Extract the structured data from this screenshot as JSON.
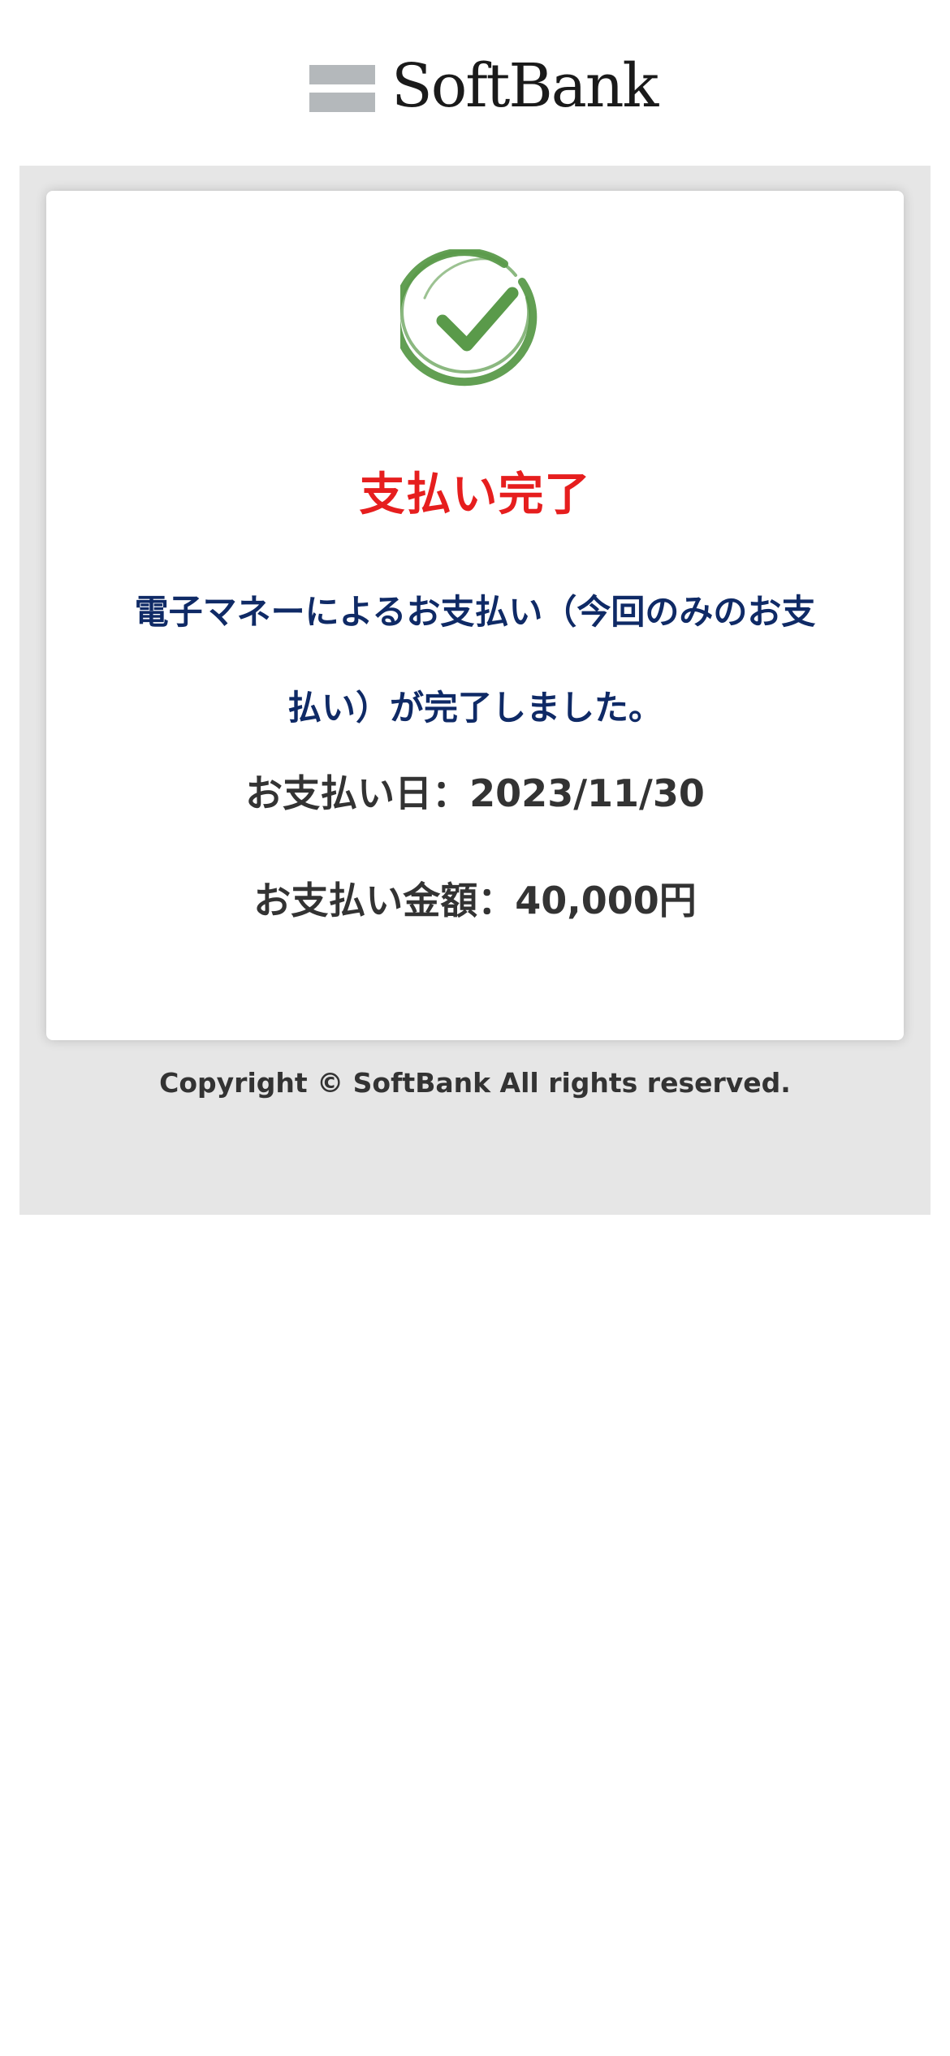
{
  "header": {
    "logo_text": "SoftBank"
  },
  "status": {
    "icon": "check-circle-icon",
    "icon_color": "#5a9a4a",
    "title": "支払い完了",
    "title_color": "#e61e1e",
    "message": "電子マネーによるお支払い（今回のみのお支払い）が完了しました。",
    "message_color": "#0f2a66",
    "payment_date": "お支払い日：2023/11/30",
    "payment_amount": "お支払い金額：40,000円"
  },
  "footer": {
    "copyright": "Copyright © SoftBank All rights reserved."
  }
}
